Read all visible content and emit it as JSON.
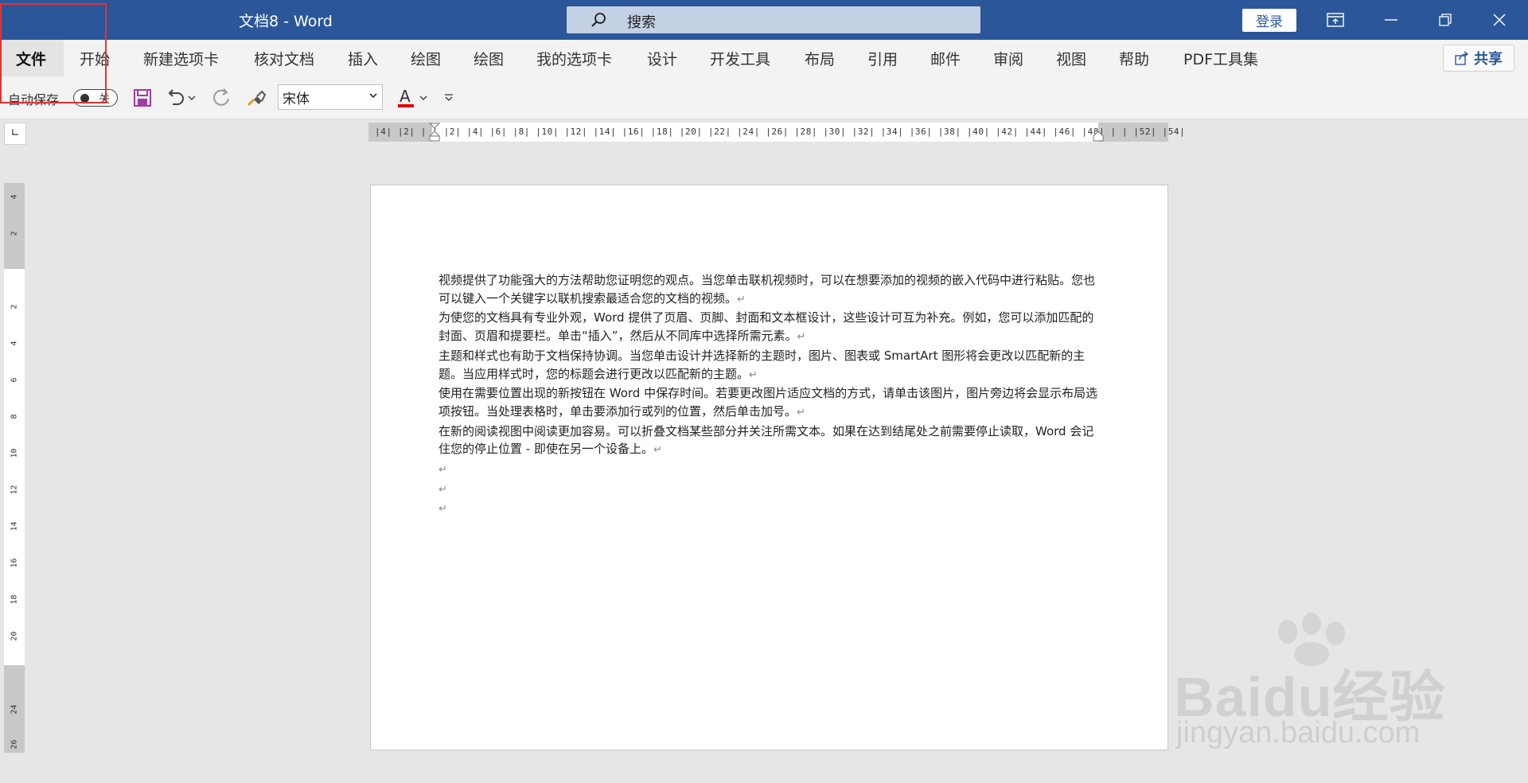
{
  "window": {
    "title": "文档8  -  Word",
    "search_placeholder": "搜索",
    "login_label": "登录",
    "controls": [
      "ribbon-display-icon",
      "minimize-icon",
      "restore-icon",
      "close-icon"
    ]
  },
  "ribbon": {
    "tabs": [
      "文件",
      "开始",
      "新建选项卡",
      "核对文档",
      "插入",
      "绘图",
      "绘图",
      "我的选项卡",
      "设计",
      "开发工具",
      "布局",
      "引用",
      "邮件",
      "审阅",
      "视图",
      "帮助",
      "PDF工具集"
    ],
    "active_tab": "文件",
    "share_label": "共享"
  },
  "quick_access": {
    "autosave_label": "自动保存",
    "autosave_state": "关",
    "font_name": "宋体",
    "font_color": "#e00000"
  },
  "ruler": {
    "horizontal_ticks": "|4|  |2|  |  |  |2|  |4|  |6|  |8|  |10|  |12|  |14|  |16|  |18|  |20|  |22|  |24|  |26|  |28|  |30|  |32|  |34|  |36|  |38|  |40|  |42|  |44|  |46|  |48|  |  |  |52|  |54|",
    "vertical_ticks": [
      "4",
      "2",
      "",
      "2",
      "4",
      "6",
      "8",
      "10",
      "12",
      "14",
      "16",
      "18",
      "20",
      "",
      "24",
      "26"
    ]
  },
  "document": {
    "paragraphs": [
      "视频提供了功能强大的方法帮助您证明您的观点。当您单击联机视频时，可以在想要添加的视频的嵌入代码中进行粘贴。您也可以键入一个关键字以联机搜索最适合您的文档的视频。",
      "为使您的文档具有专业外观，Word 提供了页眉、页脚、封面和文本框设计，这些设计可互为补充。例如，您可以添加匹配的封面、页眉和提要栏。单击“插入”，然后从不同库中选择所需元素。",
      "主题和样式也有助于文档保持协调。当您单击设计并选择新的主题时，图片、图表或 SmartArt 图形将会更改以匹配新的主题。当应用样式时，您的标题会进行更改以匹配新的主题。",
      "使用在需要位置出现的新按钮在 Word 中保存时间。若要更改图片适应文档的方式，请单击该图片，图片旁边将会显示布局选项按钮。当处理表格时，单击要添加行或列的位置，然后单击加号。",
      "在新的阅读视图中阅读更加容易。可以折叠文档某些部分并关注所需文本。如果在达到结尾处之前需要停止读取，Word 会记住您的停止位置 - 即使在另一个设备上。"
    ],
    "paragraph_mark": "↵",
    "empty_paragraph_count": 3
  },
  "watermark": {
    "logo": "Baidu经验",
    "sub": "jingyan.baidu.com"
  },
  "colors": {
    "titlebar": "#2b579a",
    "highlight_box": "#e5322d"
  }
}
